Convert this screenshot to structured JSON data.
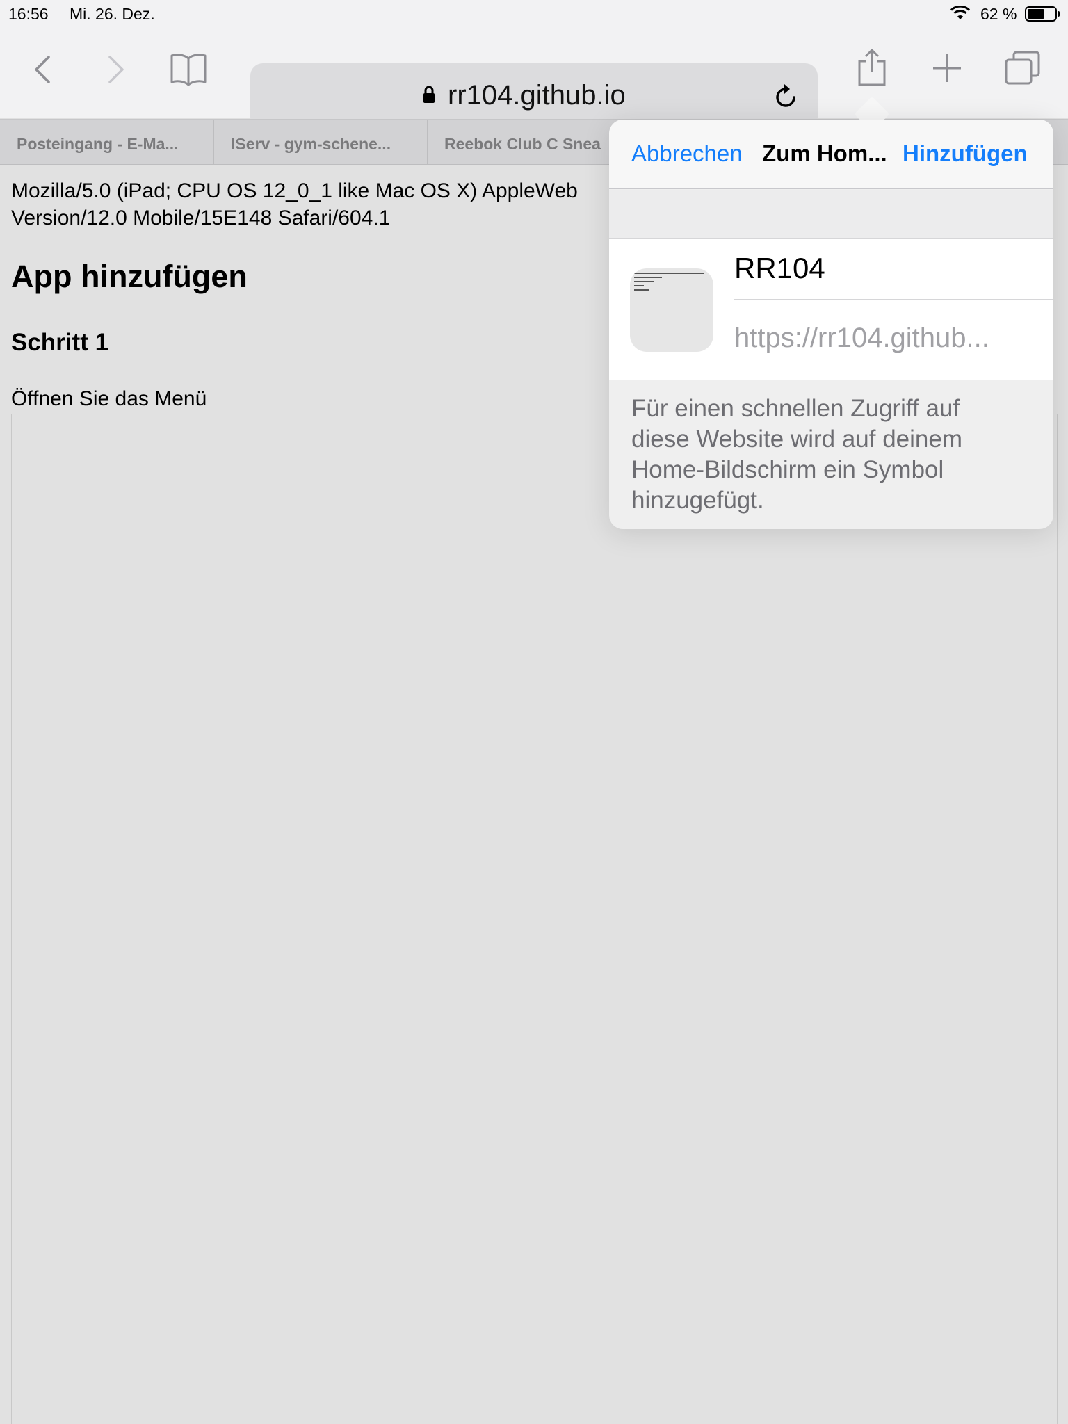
{
  "status": {
    "time": "16:56",
    "date": "Mi. 26. Dez.",
    "battery_pct": "62 %",
    "battery_level": 0.62
  },
  "toolbar": {
    "url": "rr104.github.io",
    "icons": [
      "back-icon",
      "forward-icon",
      "bookmarks-icon",
      "lock-icon",
      "reload-icon",
      "share-icon",
      "new-tab-icon",
      "tabs-icon"
    ]
  },
  "tabs": [
    {
      "label": "Posteingang - E-Ma..."
    },
    {
      "label": "IServ - gym-schene..."
    },
    {
      "label": "Reebok Club C Snea"
    }
  ],
  "page": {
    "ua_line1": "Mozilla/5.0 (iPad; CPU OS 12_0_1 like Mac OS X) AppleWeb",
    "ua_line2": "Version/12.0 Mobile/15E148 Safari/604.1",
    "heading": "App hinzufügen",
    "step": "Schritt 1",
    "instruction": "Öffnen Sie das Menü"
  },
  "popover": {
    "cancel": "Abbrechen",
    "title": "Zum Hom...",
    "add": "Hinzufügen",
    "name_value": "RR104",
    "url": "https://rr104.github...",
    "description": "Für einen schnellen Zugriff auf diese Website wird auf deinem Home-Bildschirm ein Symbol hinzugefügt."
  },
  "colors": {
    "accent": "#147efb",
    "page_bg": "#e1e1e1",
    "chrome_bg": "#f2f2f3"
  }
}
